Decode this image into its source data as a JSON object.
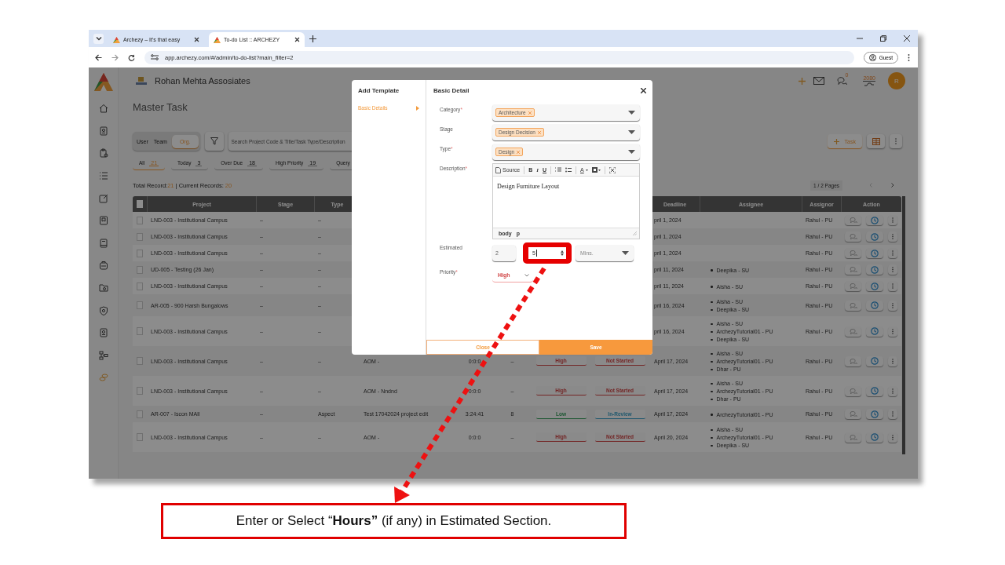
{
  "browser": {
    "tabs": [
      {
        "title": "Archezy – It's that easy",
        "selected": false
      },
      {
        "title": "To-do List :: ARCHEZY",
        "selected": true
      }
    ],
    "url": "app.archezy.com/#/admin/to-do-list?main_filter=2",
    "profile": "Guest"
  },
  "app": {
    "company": "Rohan Mehta Assosiates",
    "chat_count": "0",
    "points": "2080",
    "avatar": "R",
    "page_title": "Master Task",
    "scope_toggle": [
      {
        "label": "User",
        "selected": false
      },
      {
        "label": "Team",
        "selected": false
      },
      {
        "label": "Org.",
        "selected": true
      }
    ],
    "search": {
      "placeholder": "Search Project Code & Title/Task Type/Description"
    },
    "add_button": "Task",
    "filters": [
      {
        "label": "All",
        "count": "21",
        "selected": true
      },
      {
        "label": "Today",
        "count": "3",
        "selected": false
      },
      {
        "label": "Over Due",
        "count": "18",
        "selected": false
      },
      {
        "label": "High Priority",
        "count": "19",
        "selected": false
      },
      {
        "label": "Query",
        "selected": false
      }
    ],
    "records": {
      "total_label": "Total Record:",
      "total": "21",
      "current_label": "| Current Records:",
      "current": "20"
    },
    "pagination": "1 / 2 Pages",
    "table": {
      "select_all_checked": false,
      "columns": [
        "Project",
        "Stage",
        "Type",
        "Deadline",
        "Assignee",
        "Assignor",
        "Action"
      ],
      "rows": [
        {
          "checked": false,
          "project": "LND-003 - Institutional Campus",
          "stage": "–",
          "type": "–",
          "deadline": "pril 1, 2024",
          "assignees": [],
          "assignor": "Rahul - PU"
        },
        {
          "checked": false,
          "project": "LND-003 - Institutional Campus",
          "stage": "–",
          "type": "–",
          "deadline": "pril 1, 2024",
          "assignees": [],
          "assignor": "Rahul - PU"
        },
        {
          "checked": false,
          "project": "LND-003 - Institutional Campus",
          "stage": "–",
          "type": "–",
          "deadline": "pril 1, 2024",
          "assignees": [],
          "assignor": "Rahul - PU"
        },
        {
          "checked": false,
          "project": "UD-005 - Testing (26 Jan)",
          "stage": "–",
          "type": "–",
          "deadline": "pril 11, 2024",
          "assignees": [
            "Deepika - SU"
          ],
          "assignor": "Rahul - PU"
        },
        {
          "checked": false,
          "project": "LND-003 - Institutional Campus",
          "stage": "–",
          "type": "–",
          "deadline": "pril 11, 2024",
          "assignees": [
            "Aisha - SU"
          ],
          "assignor": "Rahul - PU"
        },
        {
          "checked": false,
          "project": "AR-005 - 900 Harsh Bungalows",
          "stage": "–",
          "type": "–",
          "deadline": "pril 16, 2024",
          "assignees": [
            "Aisha - SU",
            "Deepika - SU"
          ],
          "assignor": "Rahul - PU"
        },
        {
          "checked": false,
          "project": "LND-003 - Institutional Campus",
          "stage": "–",
          "type": "–",
          "deadline": "pril 16, 2024",
          "assignees": [
            "Aisha - SU",
            "ArchezyTutorial01 - PU",
            "Deepika - SU"
          ],
          "assignor": "Rahul - PU"
        },
        {
          "checked": false,
          "project": "LND-003 - Institutional Campus",
          "stage": "–",
          "type": "–",
          "task": "AOM -",
          "time": "0:0:0",
          "count": "–",
          "priority": {
            "text": "High",
            "kind": "high"
          },
          "status": {
            "text": "Not Started",
            "kind": "not-started"
          },
          "deadline": "April 17, 2024",
          "assignees": [
            "Aisha - SU",
            "ArchezyTutorial01 - PU",
            "Dhar - PU"
          ],
          "assignor": "Rahul - PU"
        },
        {
          "checked": false,
          "project": "LND-003 - Institutional Campus",
          "stage": "–",
          "type": "–",
          "task": "AOM - Nndnd",
          "time": "0:0:0",
          "count": "–",
          "priority": {
            "text": "High",
            "kind": "high"
          },
          "status": {
            "text": "Not Started",
            "kind": "not-started"
          },
          "deadline": "April 17, 2024",
          "assignees": [
            "Aisha - SU",
            "ArchezyTutorial01 - PU",
            "Dhar - PU"
          ],
          "assignor": "Rahul - PU"
        },
        {
          "checked": false,
          "project": "AR-007 - Iscon MAll",
          "stage": "–",
          "type": "Aspect",
          "task": "Test 17042024 project edit",
          "time": "3:24:41",
          "count": "8",
          "priority": {
            "text": "Low",
            "kind": "low"
          },
          "status": {
            "text": "In-Review",
            "kind": "in-review"
          },
          "deadline": "April 17, 2024",
          "assignees": [
            "ArchezyTutorial01 - PU"
          ],
          "assignor": "Rahul - PU"
        },
        {
          "checked": false,
          "project": "LND-003 - Institutional Campus",
          "stage": "–",
          "type": "–",
          "task": "AOM -",
          "time": "0:0:0",
          "count": "–",
          "priority": {
            "text": "High",
            "kind": "high"
          },
          "status": {
            "text": "Not Started",
            "kind": "not-started"
          },
          "deadline": "April 20, 2024",
          "assignees": [
            "Aisha - SU",
            "ArchezyTutorial01 - PU",
            "Deepika - SU"
          ],
          "assignor": "Rahul - PU"
        }
      ]
    }
  },
  "modal": {
    "title": "Add Template",
    "steps": [
      {
        "label": "Basic Details",
        "selected": true
      }
    ],
    "section_title": "Basic Detail",
    "fields": [
      {
        "kind": "select",
        "label": "Category",
        "required_mark": "*",
        "chips": [
          "Architecture"
        ]
      },
      {
        "kind": "select",
        "label": "Stage",
        "chips": [
          "Design Decision"
        ]
      },
      {
        "kind": "select",
        "label": "Type",
        "required_mark": "*",
        "chips": [
          "Design"
        ]
      },
      {
        "kind": "editor",
        "label": "Description",
        "required_mark": "*",
        "toolbar": [
          [
            {
              "kind": "source",
              "text": "Source"
            }
          ],
          [
            {
              "kind": "bold",
              "text": "B"
            },
            {
              "kind": "italic",
              "text": "I"
            },
            {
              "kind": "underline",
              "text": "U"
            }
          ],
          [
            {
              "kind": "numbered-list"
            },
            {
              "kind": "bulleted-list"
            }
          ],
          [
            {
              "kind": "text-color",
              "text": "A"
            },
            {
              "kind": "bg-color"
            }
          ],
          [
            {
              "kind": "maximize"
            }
          ]
        ],
        "content": "Design Furniture Layout",
        "path": [
          "body",
          "p"
        ]
      },
      {
        "kind": "estimate",
        "label": "Estimated",
        "values": [
          "2",
          "5"
        ],
        "unit_placeholder": "Mins."
      },
      {
        "kind": "priority",
        "label": "Priority",
        "required_mark": "*",
        "value": "High"
      }
    ],
    "close_button": "Close",
    "save_button": "Save"
  },
  "callout": {
    "text": "Enter or Select “**Hours”** (if any) in Estimated Section."
  }
}
